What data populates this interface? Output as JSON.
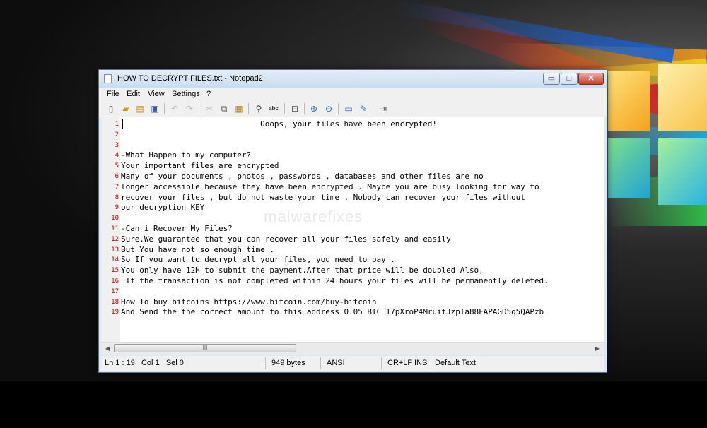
{
  "window": {
    "title": "HOW TO DECRYPT FILES.txt - Notepad2",
    "min_label": "▭",
    "max_label": "□",
    "close_label": "✕"
  },
  "menu": [
    "File",
    "Edit",
    "View",
    "Settings",
    "?"
  ],
  "toolbar": [
    "new-icon",
    "open-icon",
    "browse-icon",
    "save-icon",
    "undo-icon",
    "redo-icon",
    "cut-icon",
    "copy-icon",
    "paste-icon",
    "find-icon",
    "replace-icon",
    "word-wrap-icon",
    "zoom-in-icon",
    "zoom-out-icon",
    "view-icon",
    "settings-icon",
    "exit-icon"
  ],
  "editor": {
    "line_numbers": [
      "1",
      "2",
      "3",
      "4",
      "5",
      "6",
      "7",
      "8",
      "9",
      "10",
      "11",
      "12",
      "13",
      "14",
      "15",
      "16",
      "17",
      "18",
      "19"
    ],
    "lines": [
      "                              Ooops, your files have been encrypted!",
      "",
      "",
      "-What Happen to my computer?",
      "Your important files are encrypted",
      "Many of your documents , photos , passwords , databases and other files are no",
      "longer accessible because they have been encrypted . Maybe you are busy looking for way to",
      "recover your files , but do not waste your time . Nobody can recover your files without",
      "our decryption KEY",
      "",
      "-Can i Recover My Files?",
      "Sure.We guarantee that you can recover all your files safely and easily",
      "But You have not so enough time .",
      "So If you want to decrypt all your files, you need to pay .",
      "You only have 12H to submit the payment.After that price will be doubled Also,",
      " If the transaction is not completed within 24 hours your files will be permanently deleted.",
      "",
      "How To buy bitcoins https://www.bitcoin.com/buy-bitcoin",
      "And Send the the correct amount to this address 0.05 BTC 17pXroP4MruitJzpTa88FAPAGD5q5QAPzb"
    ],
    "watermark": "malwarefixes"
  },
  "scrollbar": {
    "left_arrow": "◀",
    "right_arrow": "▶",
    "grip": "III"
  },
  "status": {
    "position": "Ln 1 : 19   Col 1   Sel 0",
    "size": "949 bytes",
    "encoding": "ANSI",
    "line_endings": "CR+LF",
    "mode": "INS",
    "scheme": "Default Text"
  }
}
